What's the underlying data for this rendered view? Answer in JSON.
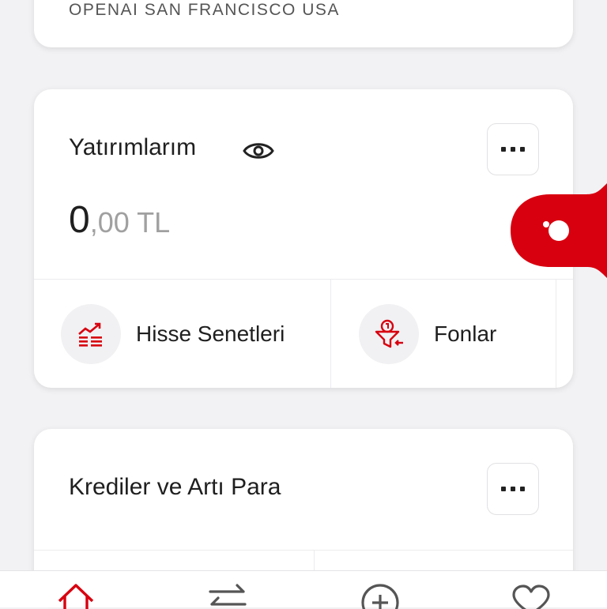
{
  "address_card": {
    "text": "OPENAI SAN FRANCISCO USA"
  },
  "investments": {
    "title": "Yatırımlarım",
    "balance_int": "0",
    "balance_dec": ",00 TL",
    "actions": [
      {
        "label": "Hisse Senetleri",
        "icon": "stocks-chart-icon"
      },
      {
        "label": "Fonlar",
        "icon": "funds-funnel-icon"
      }
    ]
  },
  "loans": {
    "title": "Krediler ve Artı Para"
  },
  "bottom_nav": {
    "items": [
      {
        "icon": "home-icon",
        "active": true
      },
      {
        "icon": "transfer-arrows-icon",
        "active": false
      },
      {
        "icon": "add-circle-icon",
        "active": false
      },
      {
        "icon": "heart-icon",
        "active": false
      }
    ]
  },
  "colors": {
    "accent": "#d8000f",
    "background": "#f2f2f4",
    "text": "#1f1f1f",
    "muted": "#a0a0a0"
  }
}
